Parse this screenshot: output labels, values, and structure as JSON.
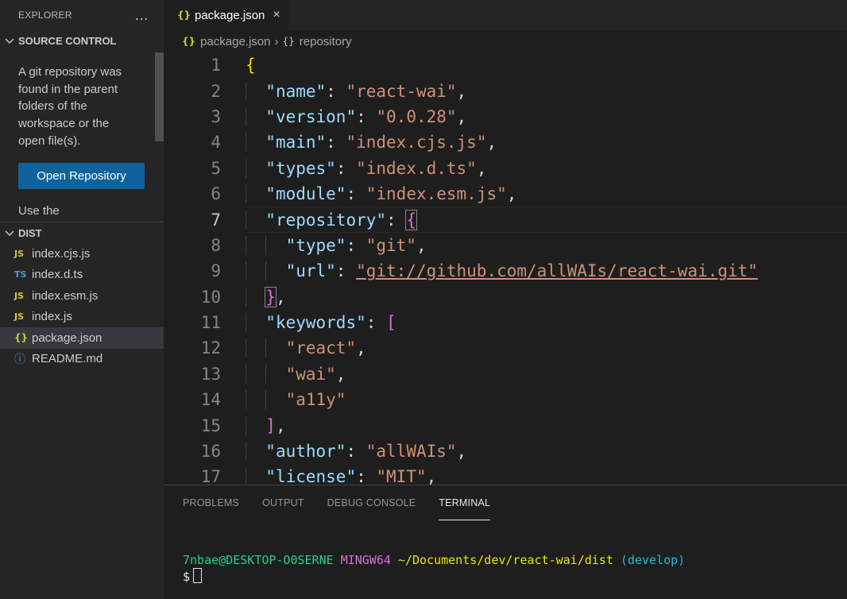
{
  "sidebar": {
    "title": "EXPLORER",
    "more_icon": "…",
    "source_control": {
      "header": "SOURCE CONTROL",
      "message": "A git repository was found in the parent folders of the workspace or the open file(s).",
      "button": "Open Repository",
      "more_text": "Use the"
    },
    "dist": {
      "header": "DIST",
      "files": [
        {
          "name": "index.cjs.js",
          "icon": "JS",
          "type": "js"
        },
        {
          "name": "index.d.ts",
          "icon": "TS",
          "type": "ts"
        },
        {
          "name": "index.esm.js",
          "icon": "JS",
          "type": "js"
        },
        {
          "name": "index.js",
          "icon": "JS",
          "type": "js"
        },
        {
          "name": "package.json",
          "icon": "{}",
          "type": "json",
          "active": true
        },
        {
          "name": "README.md",
          "icon": "ⓘ",
          "type": "info"
        }
      ]
    }
  },
  "editor": {
    "tab": {
      "icon": "{}",
      "label": "package.json",
      "close": "×"
    },
    "breadcrumb": {
      "file": "package.json",
      "separator": "›",
      "symbol_icon": "{}",
      "symbol": "repository"
    },
    "current_line": 7,
    "lines": [
      {
        "n": "1",
        "indent": "",
        "tokens": [
          {
            "t": "{",
            "c": "b1"
          }
        ]
      },
      {
        "n": "2",
        "indent": "  ",
        "tokens": [
          {
            "t": "\"name\"",
            "c": "k"
          },
          {
            "t": ": ",
            "c": "p"
          },
          {
            "t": "\"react-wai\"",
            "c": "s"
          },
          {
            "t": ",",
            "c": "p"
          }
        ]
      },
      {
        "n": "3",
        "indent": "  ",
        "tokens": [
          {
            "t": "\"version\"",
            "c": "k"
          },
          {
            "t": ": ",
            "c": "p"
          },
          {
            "t": "\"0.0.28\"",
            "c": "s"
          },
          {
            "t": ",",
            "c": "p"
          }
        ]
      },
      {
        "n": "4",
        "indent": "  ",
        "tokens": [
          {
            "t": "\"main\"",
            "c": "k"
          },
          {
            "t": ": ",
            "c": "p"
          },
          {
            "t": "\"index.cjs.js\"",
            "c": "s"
          },
          {
            "t": ",",
            "c": "p"
          }
        ]
      },
      {
        "n": "5",
        "indent": "  ",
        "tokens": [
          {
            "t": "\"types\"",
            "c": "k"
          },
          {
            "t": ": ",
            "c": "p"
          },
          {
            "t": "\"index.d.ts\"",
            "c": "s"
          },
          {
            "t": ",",
            "c": "p"
          }
        ]
      },
      {
        "n": "6",
        "indent": "  ",
        "tokens": [
          {
            "t": "\"module\"",
            "c": "k"
          },
          {
            "t": ": ",
            "c": "p"
          },
          {
            "t": "\"index.esm.js\"",
            "c": "s"
          },
          {
            "t": ",",
            "c": "p"
          }
        ]
      },
      {
        "n": "7",
        "indent": "  ",
        "tokens": [
          {
            "t": "\"repository\"",
            "c": "k"
          },
          {
            "t": ": ",
            "c": "p"
          },
          {
            "t": "{",
            "c": "b2 match"
          }
        ]
      },
      {
        "n": "8",
        "indent": "    ",
        "tokens": [
          {
            "t": "\"type\"",
            "c": "k"
          },
          {
            "t": ": ",
            "c": "p"
          },
          {
            "t": "\"git\"",
            "c": "s"
          },
          {
            "t": ",",
            "c": "p"
          }
        ]
      },
      {
        "n": "9",
        "indent": "    ",
        "tokens": [
          {
            "t": "\"url\"",
            "c": "k"
          },
          {
            "t": ": ",
            "c": "p"
          },
          {
            "t": "\"git://github.com/allWAIs/react-wai.git\"",
            "c": "s u"
          }
        ]
      },
      {
        "n": "10",
        "indent": "  ",
        "tokens": [
          {
            "t": "}",
            "c": "b2 match"
          },
          {
            "t": ",",
            "c": "p"
          }
        ]
      },
      {
        "n": "11",
        "indent": "  ",
        "tokens": [
          {
            "t": "\"keywords\"",
            "c": "k"
          },
          {
            "t": ": ",
            "c": "p"
          },
          {
            "t": "[",
            "c": "b2"
          }
        ]
      },
      {
        "n": "12",
        "indent": "    ",
        "tokens": [
          {
            "t": "\"react\"",
            "c": "s"
          },
          {
            "t": ",",
            "c": "p"
          }
        ]
      },
      {
        "n": "13",
        "indent": "    ",
        "tokens": [
          {
            "t": "\"wai\"",
            "c": "s"
          },
          {
            "t": ",",
            "c": "p"
          }
        ]
      },
      {
        "n": "14",
        "indent": "    ",
        "tokens": [
          {
            "t": "\"a11y\"",
            "c": "s"
          }
        ]
      },
      {
        "n": "15",
        "indent": "  ",
        "tokens": [
          {
            "t": "]",
            "c": "b2"
          },
          {
            "t": ",",
            "c": "p"
          }
        ]
      },
      {
        "n": "16",
        "indent": "  ",
        "tokens": [
          {
            "t": "\"author\"",
            "c": "k"
          },
          {
            "t": ": ",
            "c": "p"
          },
          {
            "t": "\"allWAIs\"",
            "c": "s"
          },
          {
            "t": ",",
            "c": "p"
          }
        ]
      },
      {
        "n": "17",
        "indent": "  ",
        "tokens": [
          {
            "t": "\"license\"",
            "c": "k"
          },
          {
            "t": ": ",
            "c": "p"
          },
          {
            "t": "\"MIT\"",
            "c": "s"
          },
          {
            "t": ",",
            "c": "p"
          }
        ]
      }
    ]
  },
  "panel": {
    "tabs": [
      {
        "label": "PROBLEMS"
      },
      {
        "label": "OUTPUT"
      },
      {
        "label": "DEBUG CONSOLE"
      },
      {
        "label": "TERMINAL",
        "active": true
      }
    ],
    "terminal": {
      "user": "7nbae@DESKTOP-O0SERNE",
      "system": "MINGW64",
      "path": "~/Documents/dev/react-wai/dist",
      "branch": "(develop)",
      "prompt": "$"
    }
  },
  "colors": {
    "accent_button": "#0e639c",
    "editor_bg": "#1e1e1e",
    "sidebar_bg": "#252526"
  }
}
